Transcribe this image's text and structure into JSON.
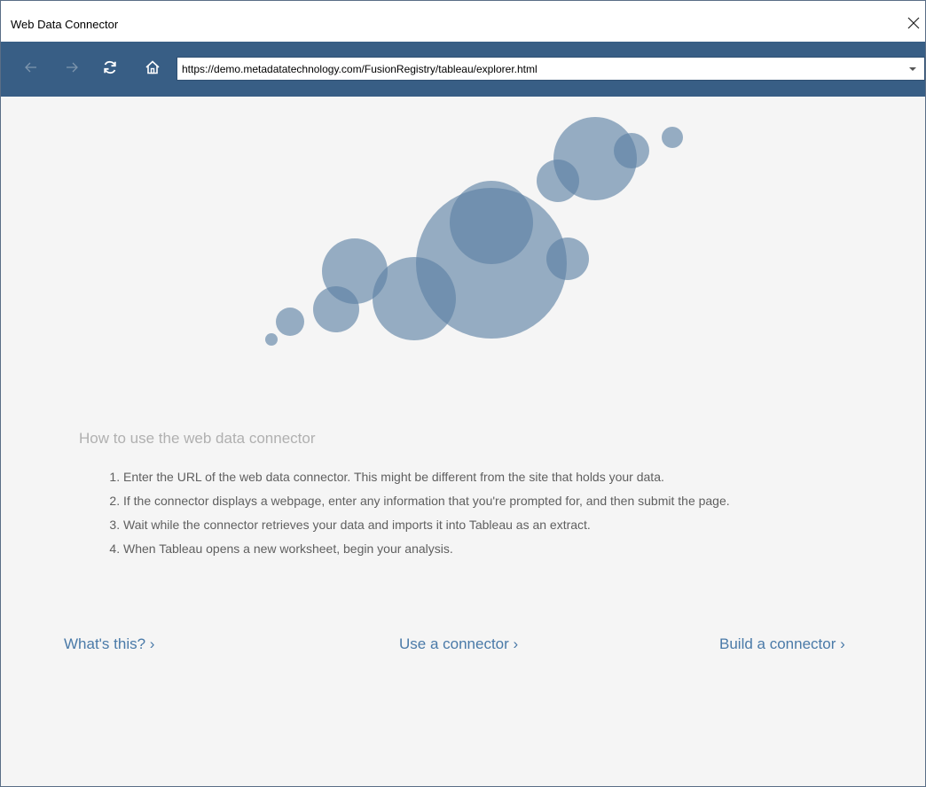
{
  "window": {
    "title": "Web Data Connector"
  },
  "toolbar": {
    "url": "https://demo.metadatatechnology.com/FusionRegistry/tableau/explorer.html",
    "back_icon": "arrow-left-icon",
    "forward_icon": "arrow-right-icon",
    "refresh_icon": "refresh-icon",
    "home_icon": "home-icon",
    "dropdown_icon": "caret-down-icon"
  },
  "help": {
    "heading": "How to use the web data connector",
    "steps": [
      "Enter the URL of the web data connector. This might be different from the site that holds your data.",
      "If the connector displays a webpage, enter any information that you're prompted for, and then submit the page.",
      "Wait while the connector retrieves your data and imports it into Tableau as an extract.",
      "When Tableau opens a new worksheet, begin your analysis."
    ]
  },
  "links": {
    "whats_this": "What's this? ›",
    "use_connector": "Use a connector ›",
    "build_connector": "Build a connector ›"
  },
  "colors": {
    "toolbar": "#385e85",
    "bubble": "#5a7fa3",
    "link": "#4a7aa8"
  }
}
